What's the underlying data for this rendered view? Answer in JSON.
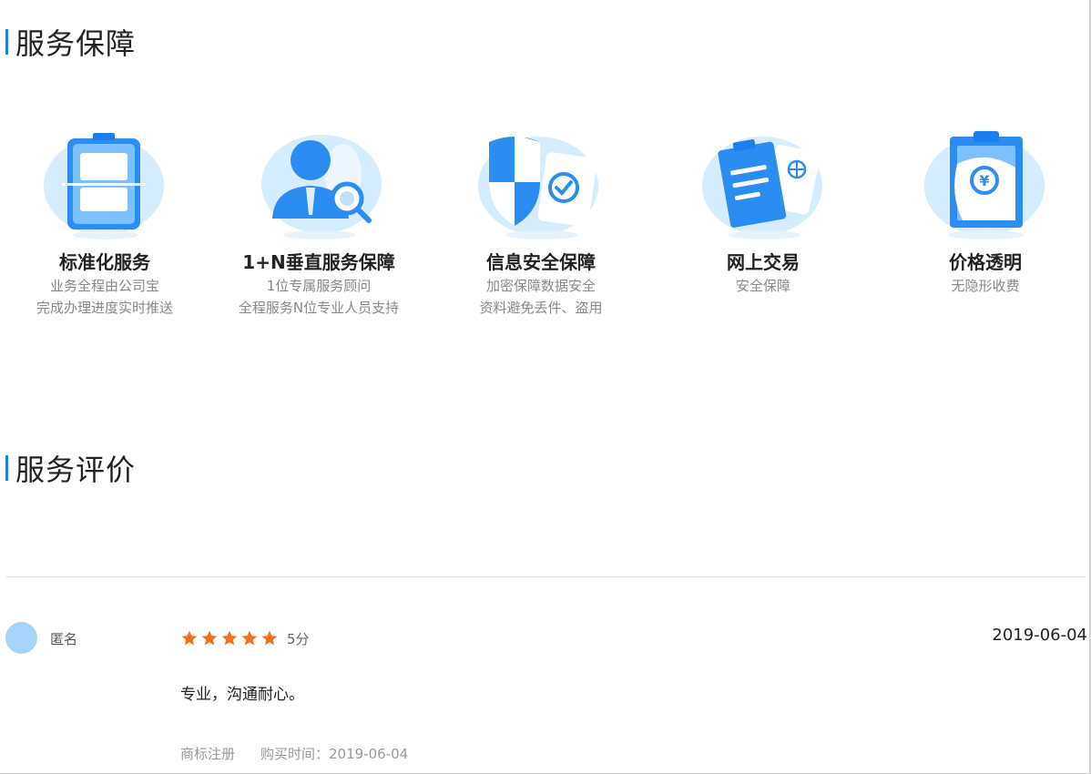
{
  "service_section": {
    "title": "服务保障"
  },
  "features": [
    {
      "icon": "tablet-icon",
      "title": "标准化服务",
      "line1": "业务全程由公司宝",
      "line2": "完成办理进度实时推送"
    },
    {
      "icon": "consultant-search-icon",
      "title": "1+N垂直服务保障",
      "line1": "1位专属服务顾问",
      "line2": "全程服务N位专业人员支持"
    },
    {
      "icon": "shield-check-icon",
      "title": "信息安全保障",
      "line1": "加密保障数据安全",
      "line2": "资料避免丢件、盗用"
    },
    {
      "icon": "document-globe-icon",
      "title": "网上交易",
      "line1": "安全保障",
      "line2": ""
    },
    {
      "icon": "clipboard-yen-icon",
      "title": "价格透明",
      "line1": "无隐形收费",
      "line2": ""
    }
  ],
  "review_section": {
    "title": "服务评价"
  },
  "review": {
    "user": "匿名",
    "rating": 5,
    "score_text": "5分",
    "date": "2019-06-04",
    "content": "专业，沟通耐心。",
    "product": "商标注册",
    "purchase_label": "购买时间：2019-06-04"
  },
  "colors": {
    "accent": "#1b7ff0",
    "star": "#f4701d",
    "avatar": "#a8d4fb",
    "icon_blob": "#d6ecff"
  }
}
